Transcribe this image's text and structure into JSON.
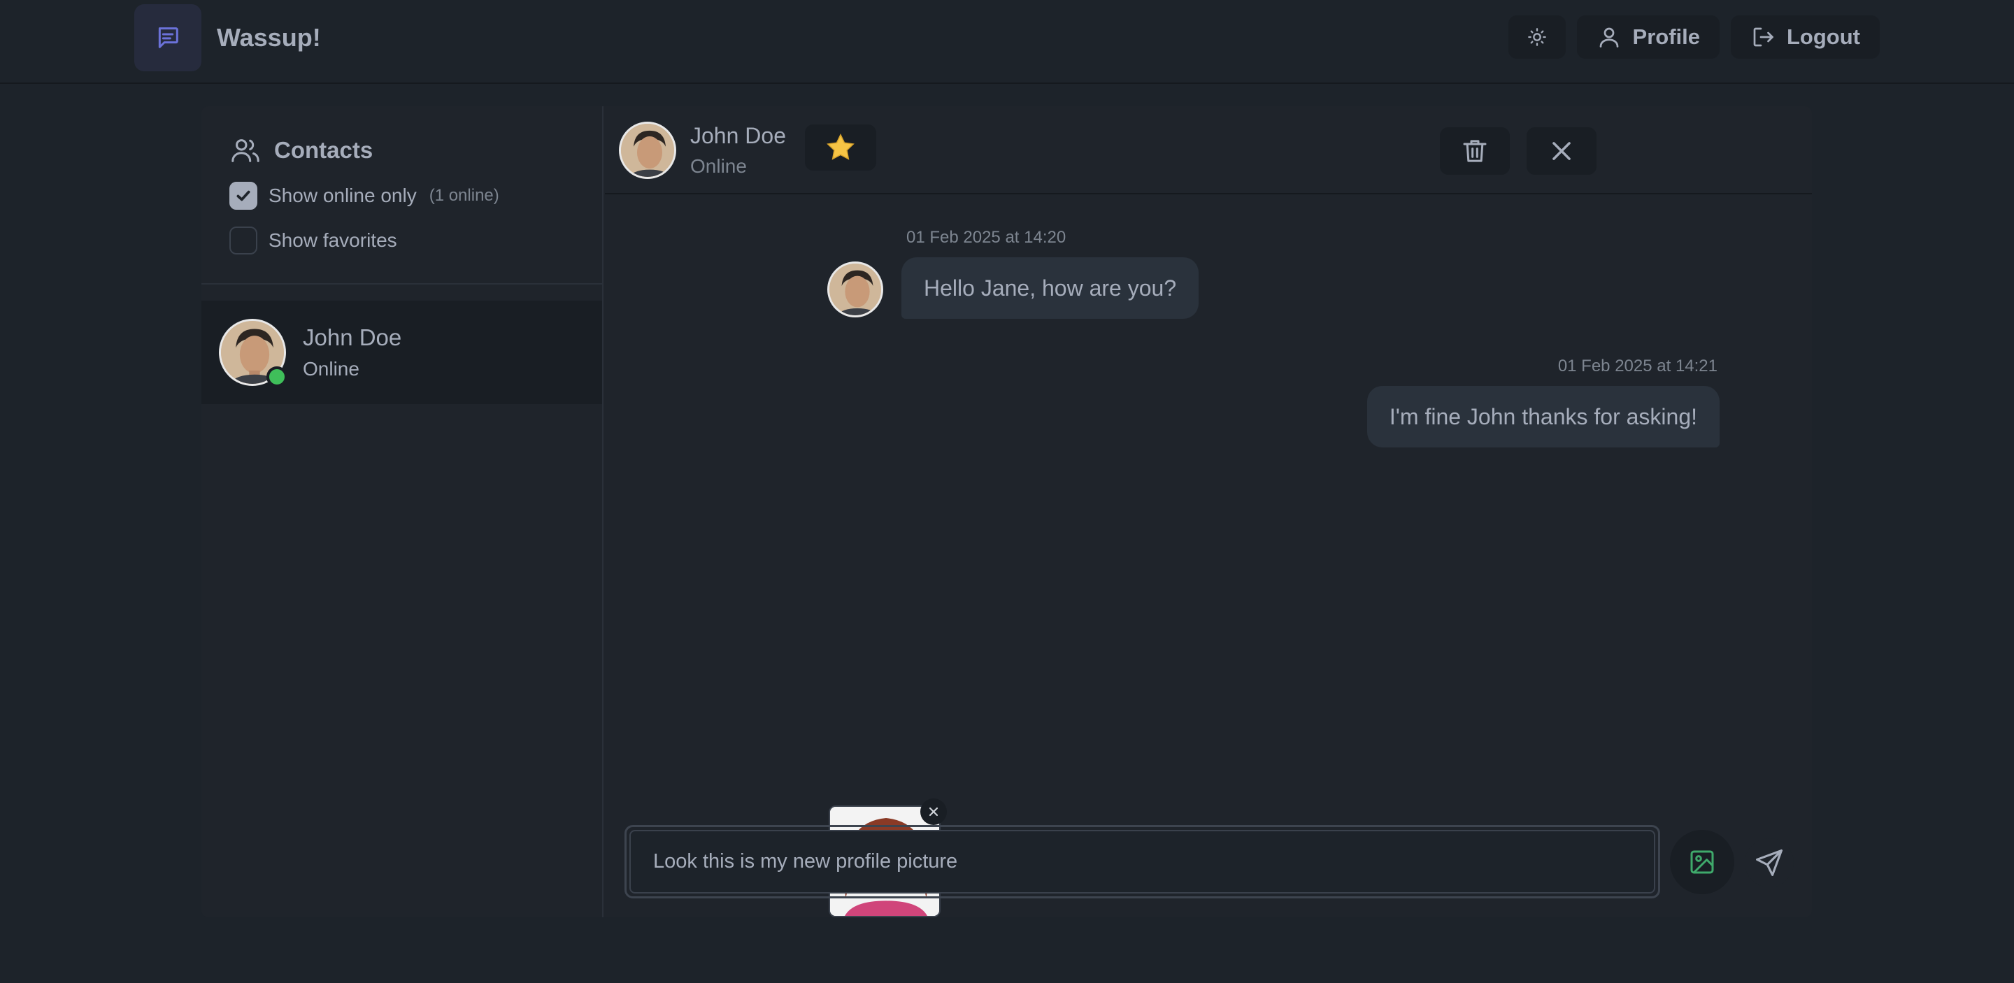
{
  "app": {
    "title": "Wassup!"
  },
  "navbar": {
    "theme_icon": "sun-icon",
    "profile_label": "Profile",
    "logout_label": "Logout"
  },
  "sidebar": {
    "title": "Contacts",
    "filters": {
      "online_label": "Show online only",
      "online_checked": true,
      "online_count": "(1 online)",
      "favorites_label": "Show favorites",
      "favorites_checked": false
    },
    "contacts": [
      {
        "name": "John Doe",
        "status": "Online",
        "online": true,
        "selected": true
      }
    ]
  },
  "chat": {
    "contact_name": "John Doe",
    "contact_status": "Online",
    "favorite_icon": "star-icon",
    "messages": [
      {
        "time": "01 Feb 2025 at 14:20",
        "text": "Hello Jane, how are you?",
        "from": "contact"
      },
      {
        "time": "01 Feb 2025 at 14:21",
        "text": "I'm fine John thanks for asking!",
        "from": "me"
      }
    ],
    "composer": {
      "value": "Look this is my new profile picture",
      "attachment": "profile-picture-preview"
    }
  },
  "colors": {
    "background": "#1d232a",
    "surface": "#1f242b",
    "bubble": "#2a323c",
    "online": "#3fbf5a",
    "brand_accent": "#6b72d9",
    "image_icon": "#3fa96b",
    "star": "#f6c445"
  }
}
